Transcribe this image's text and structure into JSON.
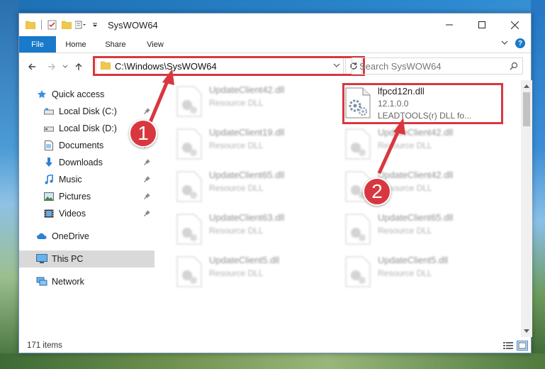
{
  "window": {
    "title": "SysWOW64"
  },
  "ribbon": {
    "tabs": [
      "File",
      "Home",
      "Share",
      "View"
    ],
    "help": "?"
  },
  "nav": {
    "address": "C:\\Windows\\SysWOW64",
    "search_placeholder": "Search SysWOW64"
  },
  "sidebar": {
    "quick_access": "Quick access",
    "items": [
      {
        "label": "Local Disk (C:)",
        "icon": "drive-icon",
        "pinned": true
      },
      {
        "label": "Local Disk (D:)",
        "icon": "drive-icon",
        "pinned": false
      },
      {
        "label": "Documents",
        "icon": "documents-icon",
        "pinned": true
      },
      {
        "label": "Downloads",
        "icon": "download-icon",
        "pinned": true
      },
      {
        "label": "Music",
        "icon": "music-icon",
        "pinned": true
      },
      {
        "label": "Pictures",
        "icon": "pictures-icon",
        "pinned": true
      },
      {
        "label": "Videos",
        "icon": "videos-icon",
        "pinned": true
      }
    ],
    "onedrive": "OneDrive",
    "this_pc": "This PC",
    "network": "Network"
  },
  "files": {
    "left_column": [
      {
        "name": "UpdateClient42.dll",
        "type": "Resource DLL"
      },
      {
        "name": "UpdateClient19.dll",
        "type": "Resource DLL"
      },
      {
        "name": "UpdateClient65.dll",
        "type": "Resource DLL"
      },
      {
        "name": "UpdateClient63.dll",
        "type": "Resource DLL"
      },
      {
        "name": "UpdateClient5.dll",
        "type": "Resource DLL"
      }
    ],
    "target": {
      "name": "lfpcd12n.dll",
      "version": "12.1.0.0",
      "description": "LEADTOOLS(r) DLL fo..."
    },
    "right_column": [
      {
        "name": "UpdateClient42.dll",
        "type": "Resource DLL"
      },
      {
        "name": "UpdateClient42.dll",
        "type": "Resource DLL"
      },
      {
        "name": "UpdateClient65.dll",
        "type": "Resource DLL"
      },
      {
        "name": "UpdateClient5.dll",
        "type": "Resource DLL"
      }
    ]
  },
  "status": {
    "item_count": "171 items"
  },
  "annotations": {
    "step1": "1",
    "step2": "2"
  },
  "colors": {
    "accent": "#1979ca",
    "highlight": "#d9373f"
  }
}
